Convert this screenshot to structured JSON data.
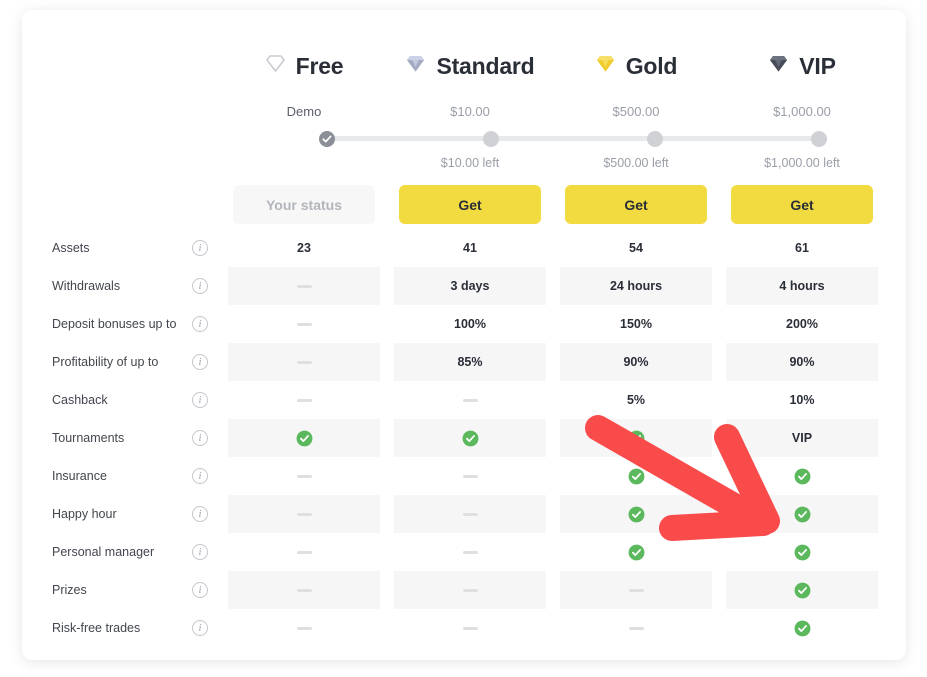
{
  "card": {
    "accent_yellow": "#f2da41",
    "check_green": "#5cb85c",
    "annotation_color": "#fa4b4b"
  },
  "tiers": [
    {
      "name": "Free",
      "gem": "diamond-outline-icon",
      "gem_color": "#c9ccd1",
      "price": "Demo",
      "left_note": "",
      "button": "Your status",
      "button_state": "current"
    },
    {
      "name": "Standard",
      "gem": "diamond-silver-icon",
      "gem_color": "#aab0c4",
      "price": "$10.00",
      "left_note": "$10.00 left",
      "button": "Get",
      "button_state": "available"
    },
    {
      "name": "Gold",
      "gem": "diamond-gold-icon",
      "gem_color": "#f2cf2e",
      "price": "$500.00",
      "left_note": "$500.00 left",
      "button": "Get",
      "button_state": "available"
    },
    {
      "name": "VIP",
      "gem": "diamond-black-icon",
      "gem_color": "#4b4f5c",
      "price": "$1,000.00",
      "left_note": "$1,000.00 left",
      "button": "Get",
      "button_state": "available"
    }
  ],
  "slider": {
    "steps": 4,
    "completed_index": 0
  },
  "table": {
    "info_glyph": "i",
    "rows": [
      {
        "label": "Assets",
        "info": true,
        "striped": false,
        "values": [
          "23",
          "41",
          "54",
          "61"
        ],
        "types": [
          "text",
          "text",
          "text",
          "text"
        ]
      },
      {
        "label": "Withdrawals",
        "info": true,
        "striped": true,
        "values": [
          "",
          "3 days",
          "24 hours",
          "4 hours"
        ],
        "types": [
          "dash",
          "text",
          "text",
          "text"
        ]
      },
      {
        "label": "Deposit bonuses up to",
        "info": true,
        "striped": false,
        "values": [
          "",
          "100%",
          "150%",
          "200%"
        ],
        "types": [
          "dash",
          "text",
          "text",
          "text"
        ]
      },
      {
        "label": "Profitability of up to",
        "info": true,
        "striped": true,
        "values": [
          "",
          "85%",
          "90%",
          "90%"
        ],
        "types": [
          "dash",
          "text",
          "text",
          "text"
        ]
      },
      {
        "label": "Cashback",
        "info": true,
        "striped": false,
        "values": [
          "",
          "",
          "5%",
          "10%"
        ],
        "types": [
          "dash",
          "dash",
          "text",
          "text"
        ]
      },
      {
        "label": "Tournaments",
        "info": true,
        "striped": true,
        "values": [
          "",
          "",
          "",
          "VIP"
        ],
        "types": [
          "check",
          "check",
          "check",
          "text"
        ]
      },
      {
        "label": "Insurance",
        "info": true,
        "striped": false,
        "values": [
          "",
          "",
          "",
          ""
        ],
        "types": [
          "dash",
          "dash",
          "check",
          "check"
        ]
      },
      {
        "label": "Happy hour",
        "info": true,
        "striped": true,
        "values": [
          "",
          "",
          "",
          ""
        ],
        "types": [
          "dash",
          "dash",
          "check",
          "check"
        ]
      },
      {
        "label": "Personal manager",
        "info": true,
        "striped": false,
        "values": [
          "",
          "",
          "",
          ""
        ],
        "types": [
          "dash",
          "dash",
          "check",
          "check"
        ]
      },
      {
        "label": "Prizes",
        "info": true,
        "striped": true,
        "values": [
          "",
          "",
          "",
          ""
        ],
        "types": [
          "dash",
          "dash",
          "dash",
          "check"
        ]
      },
      {
        "label": "Risk-free trades",
        "info": true,
        "striped": false,
        "values": [
          "",
          "",
          "",
          ""
        ],
        "types": [
          "dash",
          "dash",
          "dash",
          "check"
        ]
      }
    ]
  }
}
